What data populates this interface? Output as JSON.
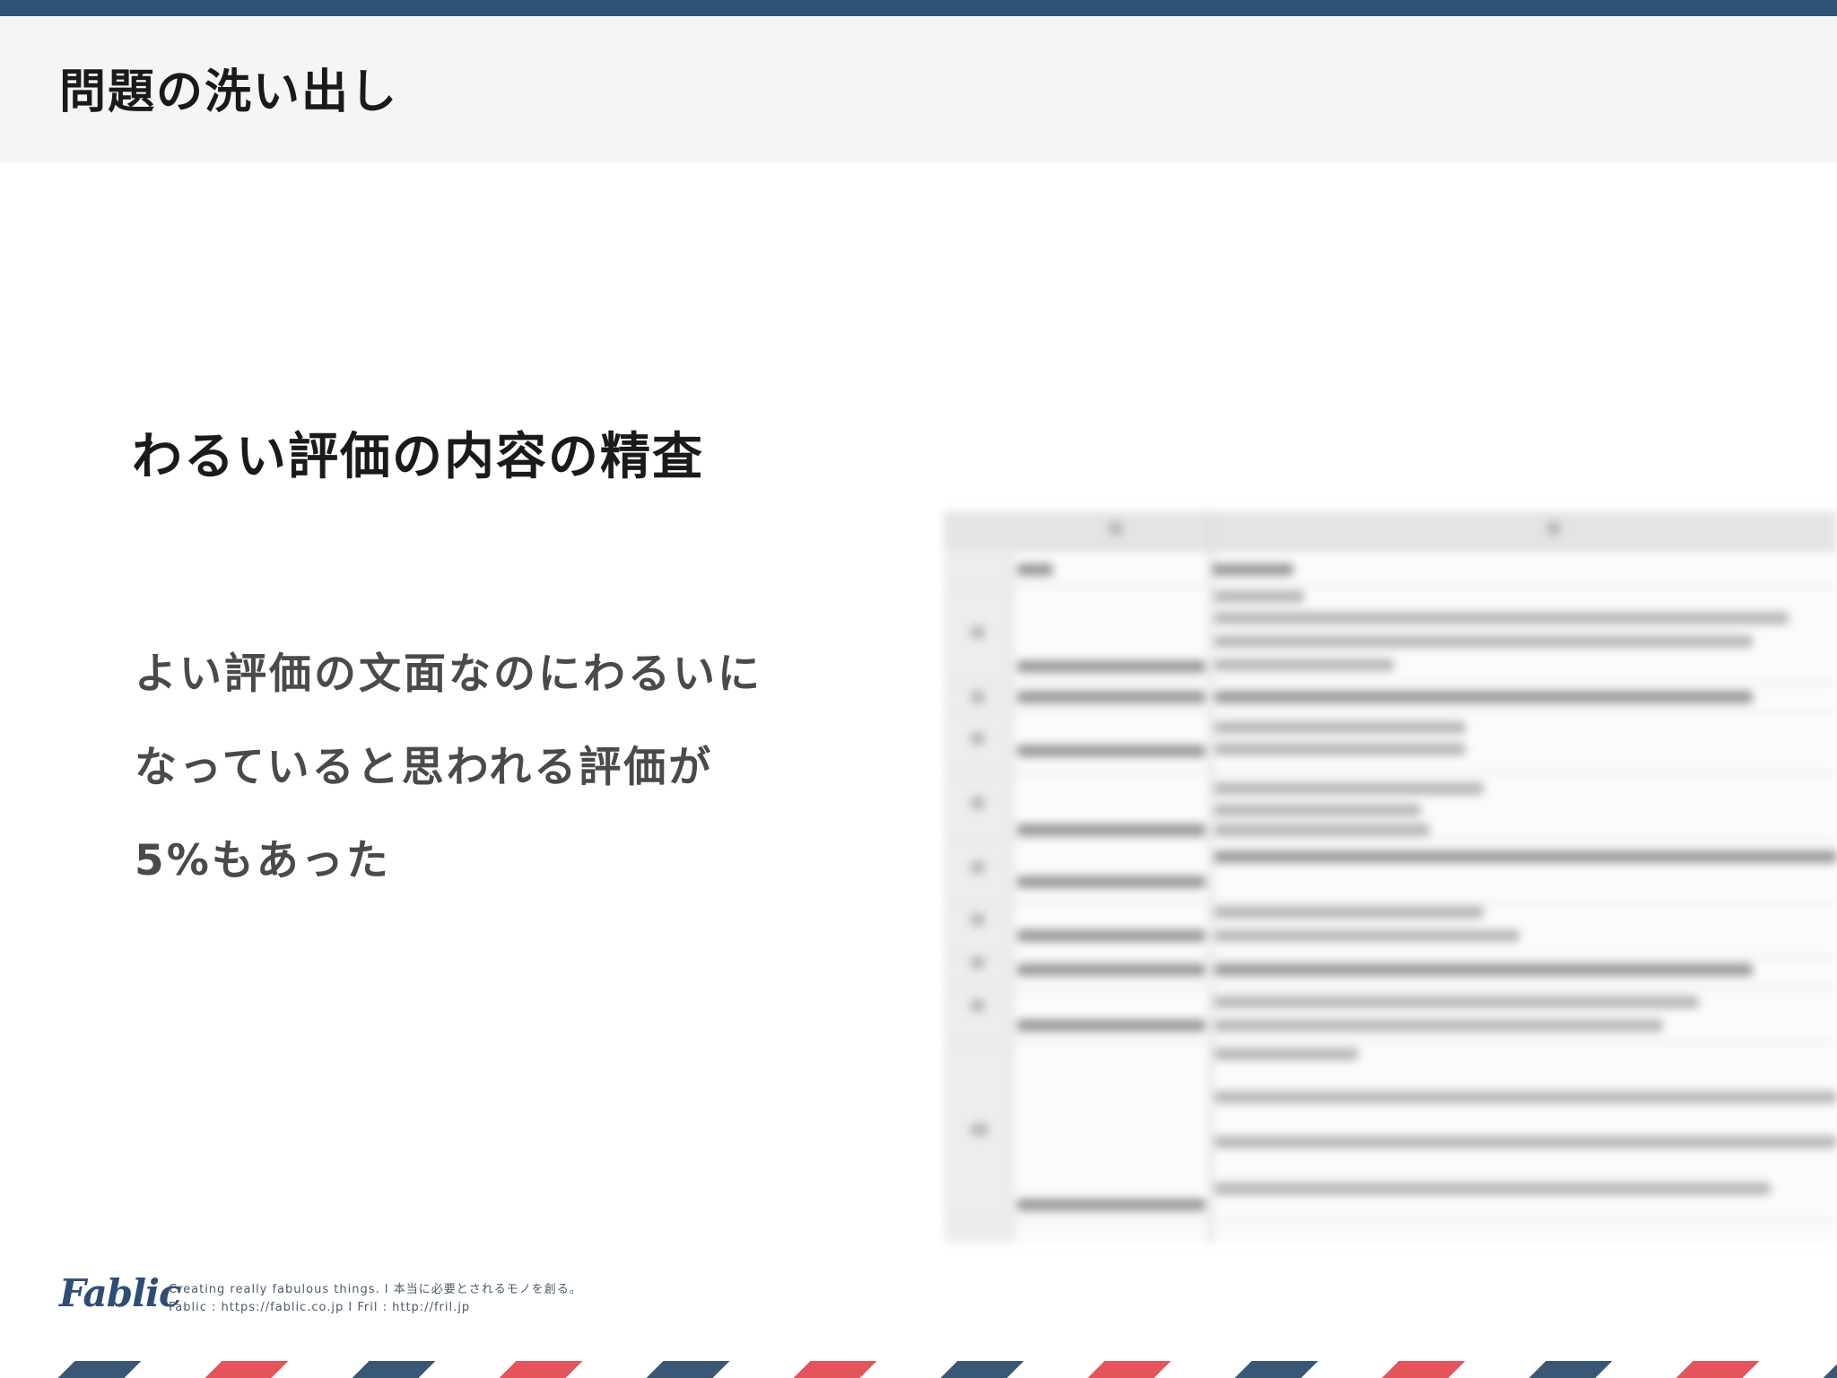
{
  "header": {
    "title": "問題の洗い出し"
  },
  "section": {
    "title": "わるい評価の内容の精査"
  },
  "body": {
    "lines": [
      "よい評価の文面なのにわるいに",
      "なっていると思われる評価が",
      "5%もあった"
    ]
  },
  "footer": {
    "logo": "Fablic",
    "tagline": "Creating really fabulous things.  I  本当に必要とされるモノを創る。",
    "links": "Fablic : https://fablic.co.jp  I  Fril : http://fril.jp"
  },
  "colors": {
    "brand_navy": "#2e5475",
    "stripe_red": "#e4545a",
    "stripe_navy": "#3a5775",
    "header_band": "#f5f4f6"
  }
}
